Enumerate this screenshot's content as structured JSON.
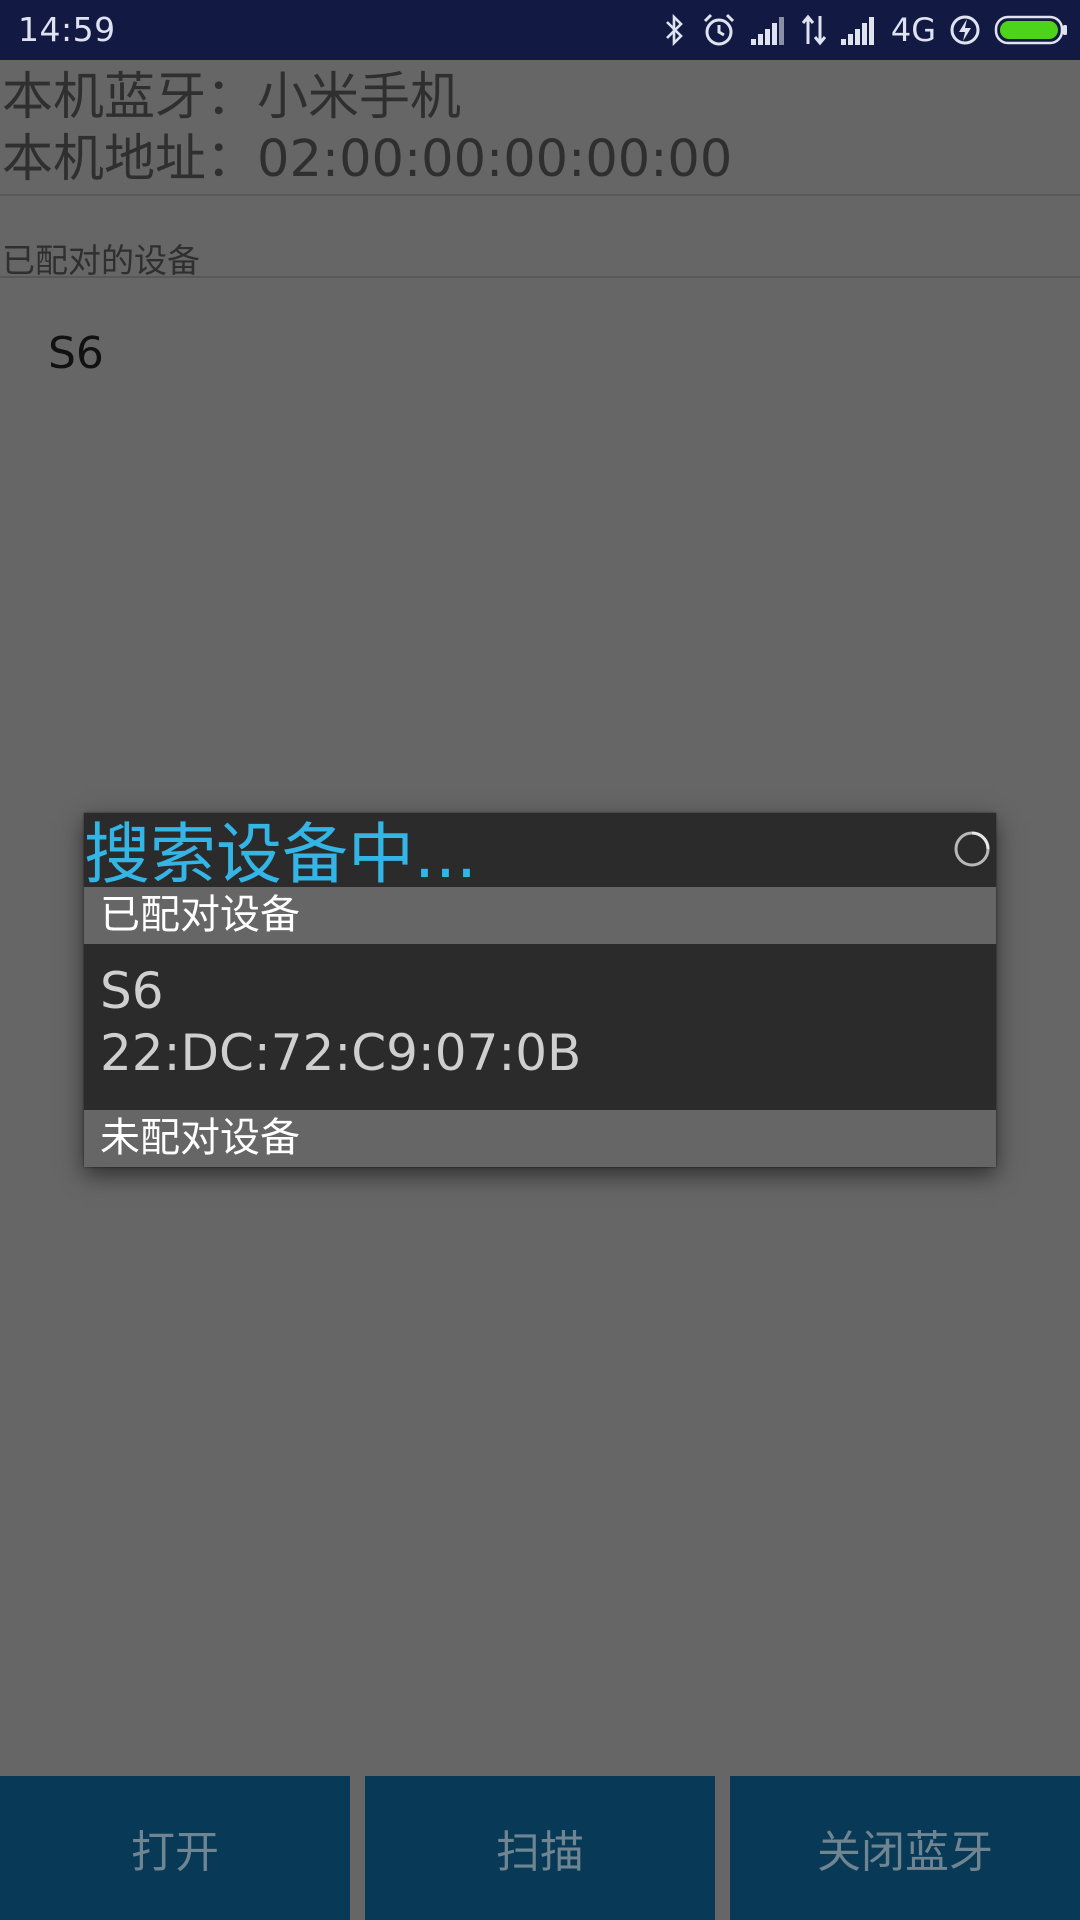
{
  "status_bar": {
    "time": "14:59",
    "network_label": "4G",
    "icons": [
      "bluetooth-icon",
      "alarm-icon",
      "signal-icon",
      "data-arrows-icon",
      "signal-icon",
      "charging-icon",
      "battery-icon"
    ],
    "battery_color": "#4cd41a"
  },
  "info": {
    "bluetooth_name_line": "本机蓝牙：小米手机",
    "address_line": "本机地址：02:00:00:00:00:00"
  },
  "paired_section": {
    "header": "已配对的设备",
    "items": [
      "S6"
    ]
  },
  "dialog": {
    "title": "搜索设备中...",
    "title_color": "#33b5e5",
    "paired_header": "已配对设备",
    "paired_devices": [
      {
        "name": "S6",
        "address": "22:DC:72:C9:07:0B"
      }
    ],
    "unpaired_header": "未配对设备"
  },
  "buttons": {
    "open": "打开",
    "scan": "扫描",
    "close_bluetooth": "关闭蓝牙"
  }
}
